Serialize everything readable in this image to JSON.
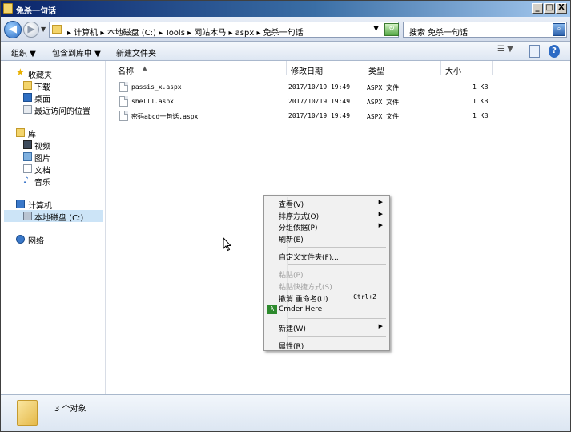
{
  "window": {
    "title": "免杀一句话",
    "buttons": {
      "minimize": "_",
      "maximize": "□",
      "close": "X"
    }
  },
  "address": {
    "path": "▸ 计算机 ▸ 本地磁盘 (C:) ▸ Tools ▸ 网站木马 ▸ aspx ▸ 免杀一句话",
    "search_placeholder": "搜索 免杀一句话"
  },
  "toolbar": {
    "organize": "组织 ▼",
    "include_in_library": "包含到库中 ▼",
    "new_folder": "新建文件夹"
  },
  "sidebar": {
    "favorites": {
      "label": "收藏夹",
      "items": [
        "下载",
        "桌面",
        "最近访问的位置"
      ]
    },
    "library": {
      "label": "库",
      "items": [
        "视频",
        "图片",
        "文档",
        "音乐"
      ]
    },
    "computer": {
      "label": "计算机",
      "items": [
        "本地磁盘 (C:)"
      ]
    },
    "network": {
      "label": "网络"
    }
  },
  "columns": {
    "name": "名称",
    "date": "修改日期",
    "type": "类型",
    "size": "大小"
  },
  "files": [
    {
      "name": "passis_x.aspx",
      "date": "2017/10/19 19:49",
      "type": "ASPX 文件",
      "size": "1 KB"
    },
    {
      "name": "shell1.aspx",
      "date": "2017/10/19 19:49",
      "type": "ASPX 文件",
      "size": "1 KB"
    },
    {
      "name": "密码abcd一句话.aspx",
      "date": "2017/10/19 19:49",
      "type": "ASPX 文件",
      "size": "1 KB"
    }
  ],
  "context_menu": {
    "view": "查看(V)",
    "sort_by": "排序方式(O)",
    "group_by": "分组依据(P)",
    "refresh": "刷新(E)",
    "customize": "自定义文件夹(F)...",
    "paste": "粘贴(P)",
    "paste_shortcut": "粘贴快捷方式(S)",
    "undo_rename": "撤消 重命名(U)",
    "undo_shortcut": "Ctrl+Z",
    "cmder": "Cmder Here",
    "new": "新建(W)",
    "properties": "属性(R)"
  },
  "status": {
    "object_count": "3 个对象"
  }
}
